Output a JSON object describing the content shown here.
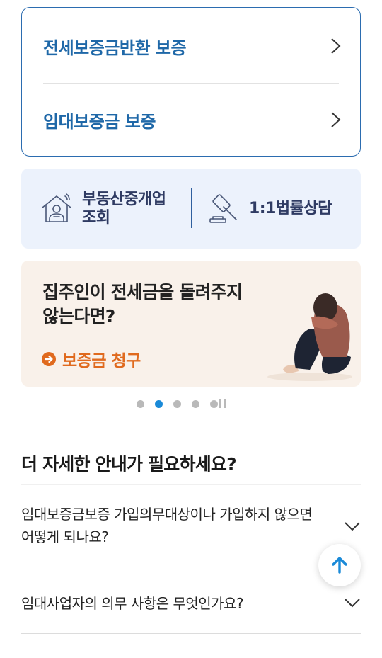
{
  "guarantee": {
    "items": [
      {
        "label": "전세보증금반환 보증"
      },
      {
        "label": "임대보증금 보증"
      }
    ]
  },
  "quick_links": {
    "broker_lookup": "부동산중개업 조회",
    "legal_consult": "1:1법률상담"
  },
  "banner": {
    "title": "집주인이 전세금을 돌려주지 않는다면?",
    "link_label": "보증금 청구"
  },
  "pager": {
    "total": 4,
    "active_index": 1
  },
  "faq": {
    "heading": "더 자세한 안내가 필요하세요?",
    "items": [
      {
        "question": "임대보증금보증 가입의무대상이나 가입하지 않으면 어떻게 되나요?"
      },
      {
        "question": "임대사업자의 의무 사항은 무엇인가요?"
      }
    ]
  },
  "colors": {
    "accent_blue": "#1f68a8",
    "border_blue": "#2b6cb0",
    "orange": "#e06a1e",
    "dot_active": "#1a8ad8",
    "dot_inactive": "#b9b9b9",
    "quick_bg": "#ecf2fc",
    "banner_bg": "#f9f1ea"
  },
  "icons": {
    "row_chevron": "chevron-right-icon",
    "broker": "house-agent-icon",
    "legal": "gavel-icon",
    "banner_link": "arrow-circle-right-icon",
    "pause": "pause-icon",
    "faq_toggle": "chevron-down-icon",
    "scroll_top": "arrow-up-icon"
  }
}
